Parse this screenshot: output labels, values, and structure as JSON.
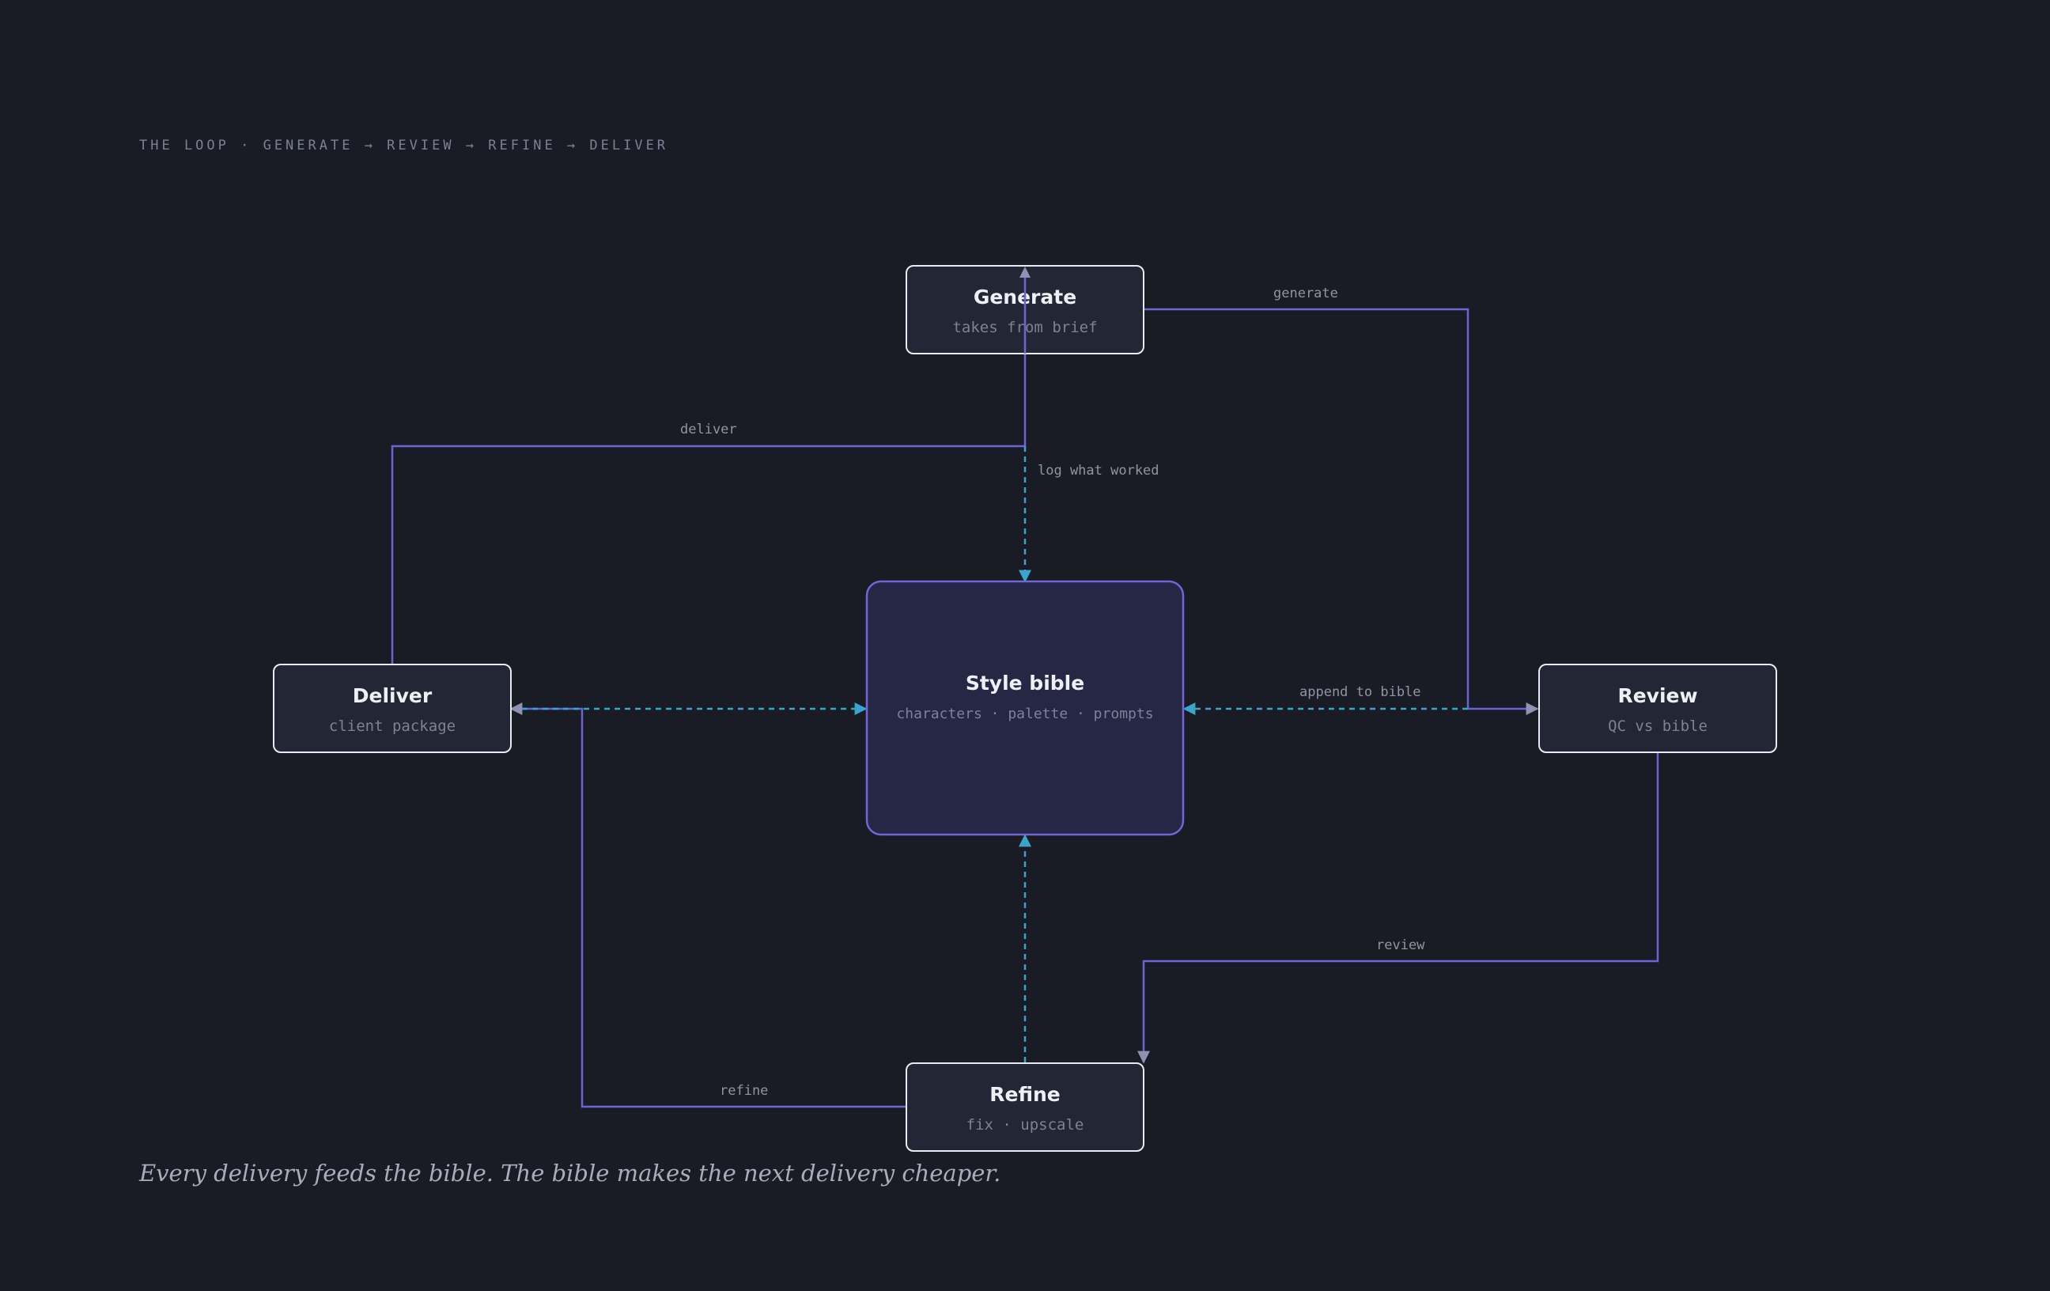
{
  "heading": "THE LOOP · GENERATE → REVIEW → REFINE → DELIVER",
  "footer": "Every delivery feeds the bible. The bible makes the next delivery cheaper.",
  "nodes": {
    "generate": {
      "title": "Generate",
      "subtitle": "takes from brief"
    },
    "review": {
      "title": "Review",
      "subtitle": "QC vs bible"
    },
    "refine": {
      "title": "Refine",
      "subtitle": "fix · upscale"
    },
    "deliver": {
      "title": "Deliver",
      "subtitle": "client package"
    },
    "bible": {
      "title": "Style bible",
      "subtitle": "characters · palette · prompts"
    }
  },
  "edges": {
    "generate": "generate",
    "review": "review",
    "refine": "refine",
    "deliver": "deliver",
    "log": "log what worked",
    "append": "append to bible"
  },
  "colors": {
    "background": "#1a1c25",
    "loop_edge": "#6b63d6",
    "bible_edge": "#3aa5c9",
    "arrowhead": "#8d93b0",
    "node_fill": "#232634",
    "node_border": "#e8eaf0",
    "bible_fill": "#262645",
    "bible_border": "#6f67d8"
  }
}
